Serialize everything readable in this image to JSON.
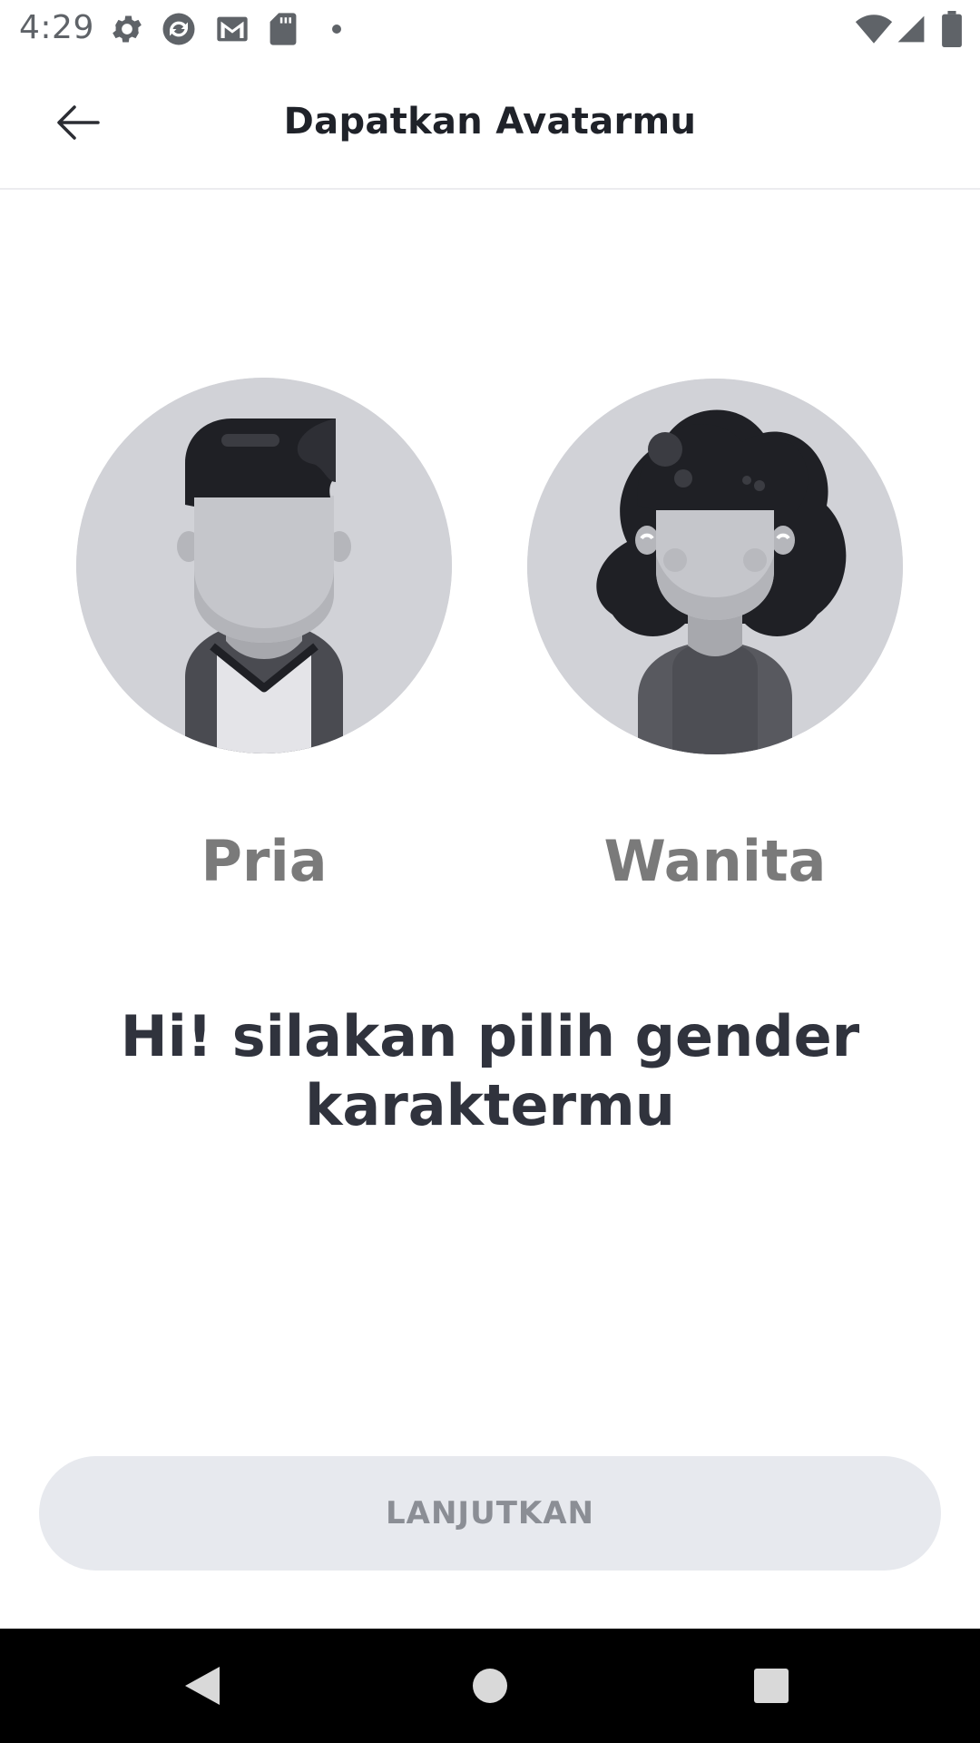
{
  "status_bar": {
    "time": "4:29",
    "icons": [
      "settings-icon",
      "sync-icon",
      "gmail-icon",
      "sd-card-icon",
      "notification-dot-icon",
      "wifi-icon",
      "cellular-signal-icon",
      "battery-icon"
    ]
  },
  "app_bar": {
    "title": "Dapatkan Avatarmu",
    "back_icon": "arrow-left-icon"
  },
  "avatars": {
    "male": {
      "label": "Pria",
      "icon": "male-avatar-icon"
    },
    "female": {
      "label": "Wanita",
      "icon": "female-avatar-icon"
    }
  },
  "headline": "Hi! silakan pilih gender karaktermu",
  "continue_button": {
    "label": "LANJUTKAN",
    "enabled": false
  },
  "nav_bar": {
    "icons": [
      "nav-back-icon",
      "nav-home-icon",
      "nav-recents-icon"
    ]
  },
  "colors": {
    "avatar_bg": "#d1d2d7",
    "hair": "#1f2025",
    "skin": "#c5c6cb",
    "shirt_dark": "#4a4b51",
    "label_gray": "#7a7a7a",
    "headline": "#30333d",
    "button_bg": "#e7e9ee",
    "button_text": "#8b8e95"
  }
}
